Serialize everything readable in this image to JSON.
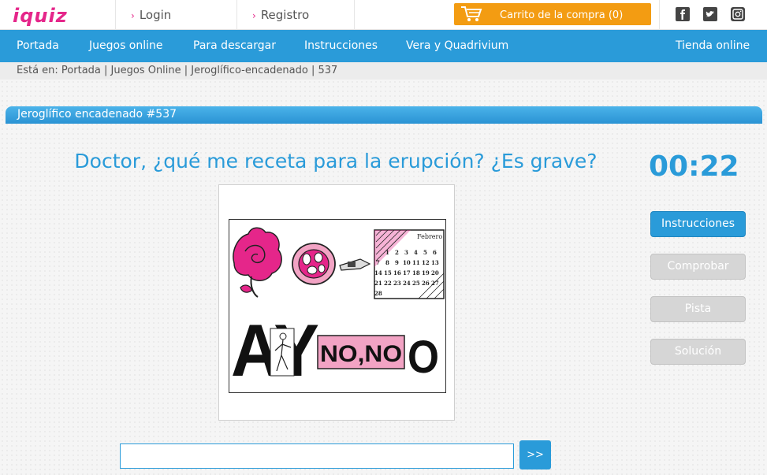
{
  "header": {
    "logo_text": "iquiz",
    "login_label": "Login",
    "register_label": "Registro",
    "cart_label": "Carrito de la compra (0)"
  },
  "nav": {
    "items": [
      "Portada",
      "Juegos online",
      "Para descargar",
      "Instrucciones",
      "Vera y Quadrivium"
    ],
    "shop_label": "Tienda online"
  },
  "breadcrumb": {
    "prefix": "Está en:",
    "items": [
      "Portada",
      "Juegos Online",
      "Jeroglífico-encadenado",
      "537"
    ],
    "full_text": "Está en: Portada | Juegos Online | Jeroglífico-encadenado | 537"
  },
  "game": {
    "title": "Jeroglífico encadenado #537",
    "question": "Doctor, ¿qué me receta para la erupción? ¿Es grave?",
    "timer": "00:22",
    "buttons": {
      "instructions": "Instrucciones",
      "check": "Comprobar",
      "hint": "Pista",
      "solution": "Solución",
      "submit": ">>"
    },
    "answer_value": "",
    "puzzle": {
      "calendar_month": "Febrero",
      "calendar_rows": [
        [
          "",
          "",
          "1",
          "2",
          "3",
          "4",
          "5",
          "6"
        ],
        [
          "7",
          "8",
          "9",
          "10",
          "11",
          "12",
          "13"
        ],
        [
          "14",
          "15",
          "16",
          "17",
          "18",
          "19",
          "20"
        ],
        [
          "21",
          "22",
          "23",
          "24",
          "25",
          "26",
          "27"
        ],
        [
          "28"
        ]
      ],
      "letters_left": "AY",
      "box_text": "NO,NO",
      "letter_right": "O"
    }
  },
  "colors": {
    "brand_blue": "#2a9bd9",
    "brand_pink": "#e5268a",
    "cart_orange": "#f39c12"
  }
}
